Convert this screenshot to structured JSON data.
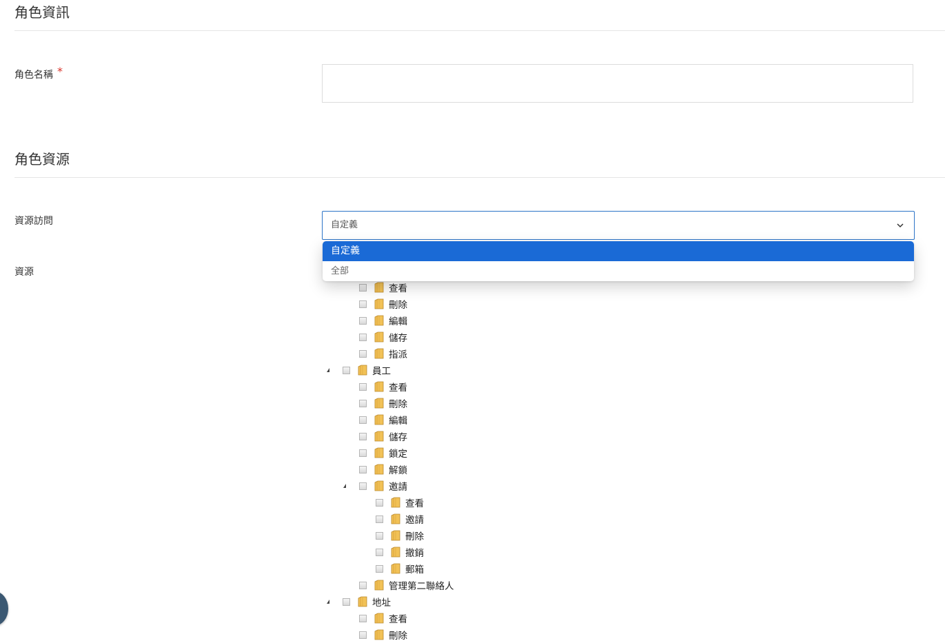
{
  "sections": {
    "role_info_title": "角色資訊",
    "role_resources_title": "角色資源"
  },
  "form": {
    "role_name_label": "角色名稱",
    "required_mark": "*",
    "role_name_value": "",
    "resource_access_label": "資源訪問",
    "resource_access_value": "自定義",
    "resources_label": "資源"
  },
  "dropdown": {
    "options": [
      "自定義",
      "全部"
    ],
    "selected_index": 0
  },
  "tree": [
    {
      "label": "查看",
      "depth": 1,
      "expanded": false
    },
    {
      "label": "刪除",
      "depth": 1,
      "expanded": false
    },
    {
      "label": "編輯",
      "depth": 1,
      "expanded": false
    },
    {
      "label": "儲存",
      "depth": 1,
      "expanded": false
    },
    {
      "label": "指派",
      "depth": 1,
      "expanded": false
    },
    {
      "label": "員工",
      "depth": 0,
      "expanded": true
    },
    {
      "label": "查看",
      "depth": 1,
      "expanded": false
    },
    {
      "label": "刪除",
      "depth": 1,
      "expanded": false
    },
    {
      "label": "編輯",
      "depth": 1,
      "expanded": false
    },
    {
      "label": "儲存",
      "depth": 1,
      "expanded": false
    },
    {
      "label": "鎖定",
      "depth": 1,
      "expanded": false
    },
    {
      "label": "解鎖",
      "depth": 1,
      "expanded": false
    },
    {
      "label": "邀請",
      "depth": 1,
      "expanded": true
    },
    {
      "label": "查看",
      "depth": 2,
      "expanded": false
    },
    {
      "label": "邀請",
      "depth": 2,
      "expanded": false
    },
    {
      "label": "刪除",
      "depth": 2,
      "expanded": false
    },
    {
      "label": "撤銷",
      "depth": 2,
      "expanded": false
    },
    {
      "label": "郵箱",
      "depth": 2,
      "expanded": false
    },
    {
      "label": "管理第二聯絡人",
      "depth": 1,
      "expanded": false
    },
    {
      "label": "地址",
      "depth": 0,
      "expanded": true
    },
    {
      "label": "查看",
      "depth": 1,
      "expanded": false
    },
    {
      "label": "刪除",
      "depth": 1,
      "expanded": false
    }
  ],
  "colors": {
    "accent": "#1a6ad6",
    "select_border": "#2b73c7",
    "required": "#d9342b",
    "fab": "#3b5872"
  }
}
